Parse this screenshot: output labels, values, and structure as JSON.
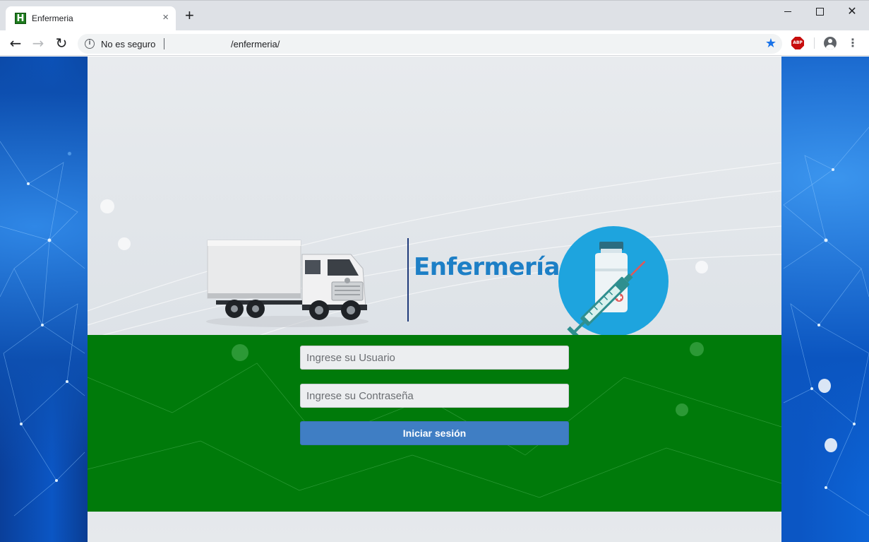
{
  "browser": {
    "tab_title": "Enfermeria",
    "favicon_letter": "H",
    "tab_close": "×",
    "new_tab": "+",
    "security_label": "No es seguro",
    "url": "/enfermeria/",
    "abp_label": "ABP",
    "icons": [
      "back-icon",
      "forward-icon",
      "reload-icon",
      "info-icon",
      "star-icon",
      "abp-icon",
      "profile-icon",
      "menu-icon"
    ]
  },
  "page": {
    "brand_title": "Enfermería",
    "login": {
      "username_placeholder": "Ingrese su Usuario",
      "password_placeholder": "Ingrese su Contraseña",
      "submit_label": "Iniciar sesión"
    }
  },
  "colors": {
    "login_band": "#007a0a",
    "submit_button": "#3f7ec4",
    "brand_title": "#1d7fc6",
    "vaccine_circle": "#1ea4de",
    "side_background": "#0b56c4"
  }
}
